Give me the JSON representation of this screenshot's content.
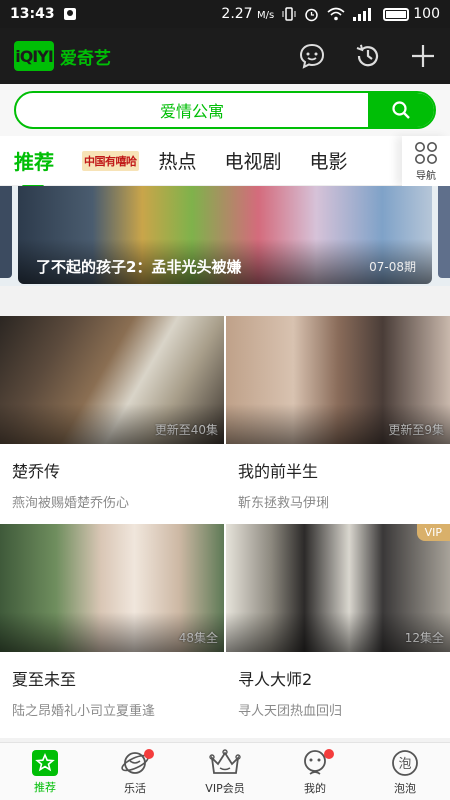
{
  "status_bar": {
    "time": "13:43",
    "network_speed": "2.27",
    "network_unit": "M/s",
    "battery": "100"
  },
  "app": {
    "logo_text": "iQIYI",
    "name": "爱奇艺"
  },
  "search": {
    "placeholder": "爱情公寓"
  },
  "tabs": [
    {
      "label": "推荐",
      "active": true
    },
    {
      "label": "中国有嘻哈",
      "active": false
    },
    {
      "label": "热点",
      "active": false
    },
    {
      "label": "电视剧",
      "active": false
    },
    {
      "label": "电影",
      "active": false
    }
  ],
  "nav_more_label": "导航",
  "banner": {
    "title": "了不起的孩子2：孟非光头被嫌",
    "period": "07-08期"
  },
  "cards": [
    {
      "title": "楚乔传",
      "subtitle": "燕洵被赐婚楚乔伤心",
      "badge": "更新至40集"
    },
    {
      "title": "我的前半生",
      "subtitle": "靳东拯救马伊琍",
      "badge": "更新至9集"
    },
    {
      "title": "夏至未至",
      "subtitle": "陆之昂婚礼小司立夏重逢",
      "badge": "48集全"
    },
    {
      "title": "寻人大师2",
      "subtitle": "寻人天团热血回归",
      "badge": "12集全",
      "vip": "VIP"
    }
  ],
  "bottom_nav": [
    {
      "label": "推荐",
      "active": true
    },
    {
      "label": "乐活",
      "dot": true
    },
    {
      "label": "VIP会员"
    },
    {
      "label": "我的",
      "dot": true
    },
    {
      "label": "泡泡"
    }
  ],
  "colors": {
    "accent": "#00be06",
    "dark_bar": "#1c1c1c",
    "vip_gold": "#d9b06a",
    "dot_red": "#f43c3c"
  }
}
